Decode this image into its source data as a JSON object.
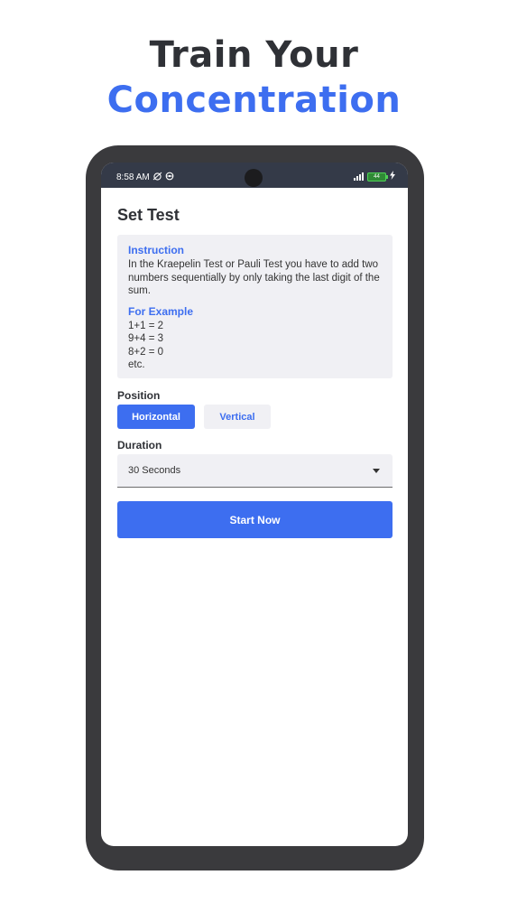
{
  "headline": {
    "line1": "Train Your",
    "line2": "Concentration"
  },
  "status_bar": {
    "time": "8:58 AM",
    "battery": "44",
    "icons": [
      "alarm-off-icon",
      "vpn-icon",
      "signal-icon",
      "battery-icon",
      "charging-icon"
    ]
  },
  "page": {
    "title": "Set Test"
  },
  "instruction": {
    "heading": "Instruction",
    "text": "In the Kraepelin Test or Pauli Test you have to add two numbers sequentially by only taking the last digit of the sum.",
    "example_heading": "For Example",
    "examples": [
      "1+1 = 2",
      "9+4 = 3",
      "8+2 = 0",
      "etc."
    ]
  },
  "position": {
    "label": "Position",
    "options": [
      "Horizontal",
      "Vertical"
    ],
    "selected": "Horizontal"
  },
  "duration": {
    "label": "Duration",
    "selected": "30 Seconds"
  },
  "actions": {
    "start_label": "Start Now"
  },
  "colors": {
    "accent": "#3d6ef0",
    "headline_dark": "#2f3136",
    "phone_frame": "#3a3a3d",
    "status_bar": "#343a48",
    "panel_bg": "#f0f0f4"
  }
}
